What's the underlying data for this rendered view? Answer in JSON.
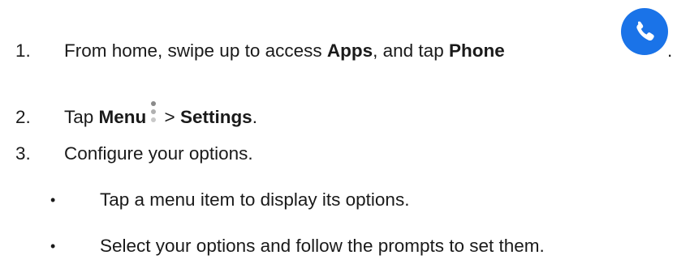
{
  "steps": [
    {
      "number": "1.",
      "parts": {
        "a": "From home, swipe up to access ",
        "b": "Apps",
        "c": ", and tap ",
        "d": "Phone",
        "e": "."
      }
    },
    {
      "number": "2.",
      "parts": {
        "a": "Tap ",
        "b": "Menu",
        "c": " > ",
        "d": "Settings",
        "e": "."
      }
    },
    {
      "number": "3.",
      "text": "Configure your options."
    }
  ],
  "bullets": [
    "Tap a menu item to display its options.",
    "Select your options and follow the prompts to set them."
  ],
  "bullet_symbol": "•",
  "icons": {
    "phone": "phone-icon",
    "menu": "more-vertical-icon"
  },
  "colors": {
    "phone_icon_bg": "#1a73e8",
    "menu_dots": "#9a9a9a"
  }
}
